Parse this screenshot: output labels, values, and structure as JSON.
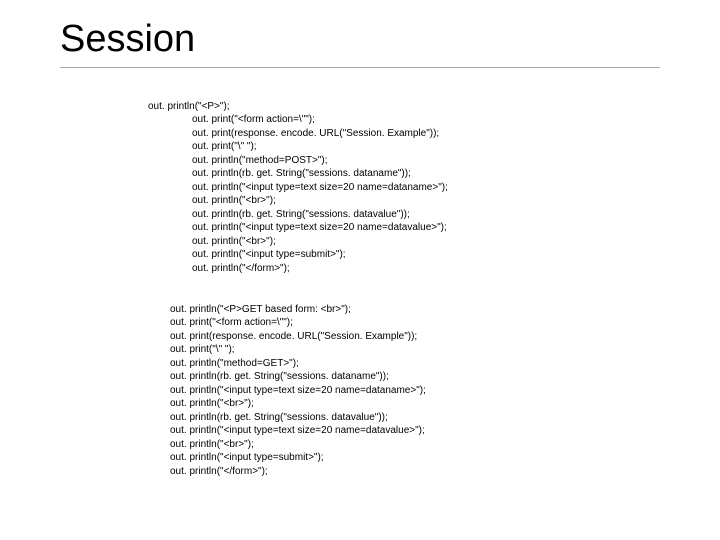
{
  "title": "Session",
  "code": {
    "block1": [
      "out. println(\"<P>\");",
      "out. print(\"<form action=\\\"\");",
      "out. print(response. encode. URL(\"Session. Example\"));",
      "out. print(\"\\\" \");",
      "out. println(\"method=POST>\");",
      "out. println(rb. get. String(\"sessions. dataname\"));",
      "out. println(\"<input type=text size=20 name=dataname>\");",
      "out. println(\"<br>\");",
      "out. println(rb. get. String(\"sessions. datavalue\"));",
      "out. println(\"<input type=text size=20 name=datavalue>\");",
      "out. println(\"<br>\");",
      "out. println(\"<input type=submit>\");",
      "out. println(\"</form>\");"
    ],
    "block2": [
      "out. println(\"<P>GET based form: <br>\");",
      "out. print(\"<form action=\\\"\");",
      "out. print(response. encode. URL(\"Session. Example\"));",
      "out. print(\"\\\" \");",
      "out. println(\"method=GET>\");",
      "out. println(rb. get. String(\"sessions. dataname\"));",
      "out. println(\"<input type=text size=20 name=dataname>\");",
      "out. println(\"<br>\");",
      "out. println(rb. get. String(\"sessions. datavalue\"));",
      "out. println(\"<input type=text size=20 name=datavalue>\");",
      "out. println(\"<br>\");",
      "out. println(\"<input type=submit>\");",
      "out. println(\"</form>\");"
    ]
  }
}
